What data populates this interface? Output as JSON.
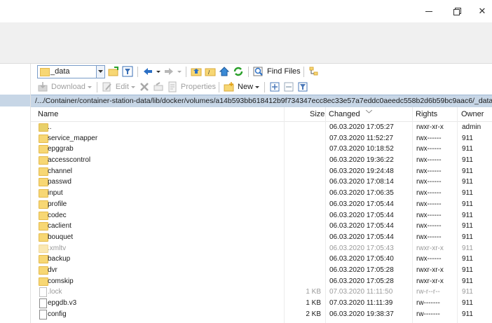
{
  "window": {
    "min_glyph": "—",
    "max_glyph": "❐",
    "close_glyph": "✕"
  },
  "toolbar": {
    "location": "_data",
    "find_files": "Find Files",
    "download": "Download",
    "edit": "Edit",
    "properties": "Properties",
    "new": "New"
  },
  "path": "/.../Container/container-station-data/lib/docker/volumes/a14b593bb618412b9f734347ecc8ec33e57a7eddc0aeedc558b2d6b59bc9aac6/_data/",
  "columns": {
    "name": "Name",
    "size": "Size",
    "changed": "Changed",
    "rights": "Rights",
    "owner": "Owner"
  },
  "files": [
    {
      "name": "..",
      "size": "",
      "changed": "06.03.2020 17:05:27",
      "rights": "rwxr-xr-x",
      "owner": "admin",
      "type": "parent",
      "hidden": false
    },
    {
      "name": "service_mapper",
      "size": "",
      "changed": "07.03.2020 11:52:27",
      "rights": "rwx------",
      "owner": "911",
      "type": "folder",
      "hidden": false
    },
    {
      "name": "epggrab",
      "size": "",
      "changed": "07.03.2020 10:18:52",
      "rights": "rwx------",
      "owner": "911",
      "type": "folder",
      "hidden": false
    },
    {
      "name": "accesscontrol",
      "size": "",
      "changed": "06.03.2020 19:36:22",
      "rights": "rwx------",
      "owner": "911",
      "type": "folder",
      "hidden": false
    },
    {
      "name": "channel",
      "size": "",
      "changed": "06.03.2020 19:24:48",
      "rights": "rwx------",
      "owner": "911",
      "type": "folder",
      "hidden": false
    },
    {
      "name": "passwd",
      "size": "",
      "changed": "06.03.2020 17:08:14",
      "rights": "rwx------",
      "owner": "911",
      "type": "folder",
      "hidden": false
    },
    {
      "name": "input",
      "size": "",
      "changed": "06.03.2020 17:06:35",
      "rights": "rwx------",
      "owner": "911",
      "type": "folder",
      "hidden": false
    },
    {
      "name": "profile",
      "size": "",
      "changed": "06.03.2020 17:05:44",
      "rights": "rwx------",
      "owner": "911",
      "type": "folder",
      "hidden": false
    },
    {
      "name": "codec",
      "size": "",
      "changed": "06.03.2020 17:05:44",
      "rights": "rwx------",
      "owner": "911",
      "type": "folder",
      "hidden": false
    },
    {
      "name": "caclient",
      "size": "",
      "changed": "06.03.2020 17:05:44",
      "rights": "rwx------",
      "owner": "911",
      "type": "folder",
      "hidden": false
    },
    {
      "name": "bouquet",
      "size": "",
      "changed": "06.03.2020 17:05:44",
      "rights": "rwx------",
      "owner": "911",
      "type": "folder",
      "hidden": false
    },
    {
      "name": ".xmltv",
      "size": "",
      "changed": "06.03.2020 17:05:43",
      "rights": "rwxr-xr-x",
      "owner": "911",
      "type": "folder",
      "hidden": true
    },
    {
      "name": "backup",
      "size": "",
      "changed": "06.03.2020 17:05:40",
      "rights": "rwx------",
      "owner": "911",
      "type": "folder",
      "hidden": false
    },
    {
      "name": "dvr",
      "size": "",
      "changed": "06.03.2020 17:05:28",
      "rights": "rwxr-xr-x",
      "owner": "911",
      "type": "folder",
      "hidden": false
    },
    {
      "name": "comskip",
      "size": "",
      "changed": "06.03.2020 17:05:28",
      "rights": "rwxr-xr-x",
      "owner": "911",
      "type": "folder",
      "hidden": false
    },
    {
      "name": ".lock",
      "size": "1 KB",
      "changed": "07.03.2020 11:11:50",
      "rights": "rw-r--r--",
      "owner": "911",
      "type": "file",
      "hidden": true
    },
    {
      "name": "epgdb.v3",
      "size": "1 KB",
      "changed": "07.03.2020 11:11:39",
      "rights": "rw-------",
      "owner": "911",
      "type": "file",
      "hidden": false
    },
    {
      "name": "config",
      "size": "2 KB",
      "changed": "06.03.2020 19:38:37",
      "rights": "rw-------",
      "owner": "911",
      "type": "file",
      "hidden": false
    }
  ],
  "colors": {
    "path_bar": "#c7d6e6",
    "folder": "#f7d774",
    "accent": "#2b6fc4"
  }
}
